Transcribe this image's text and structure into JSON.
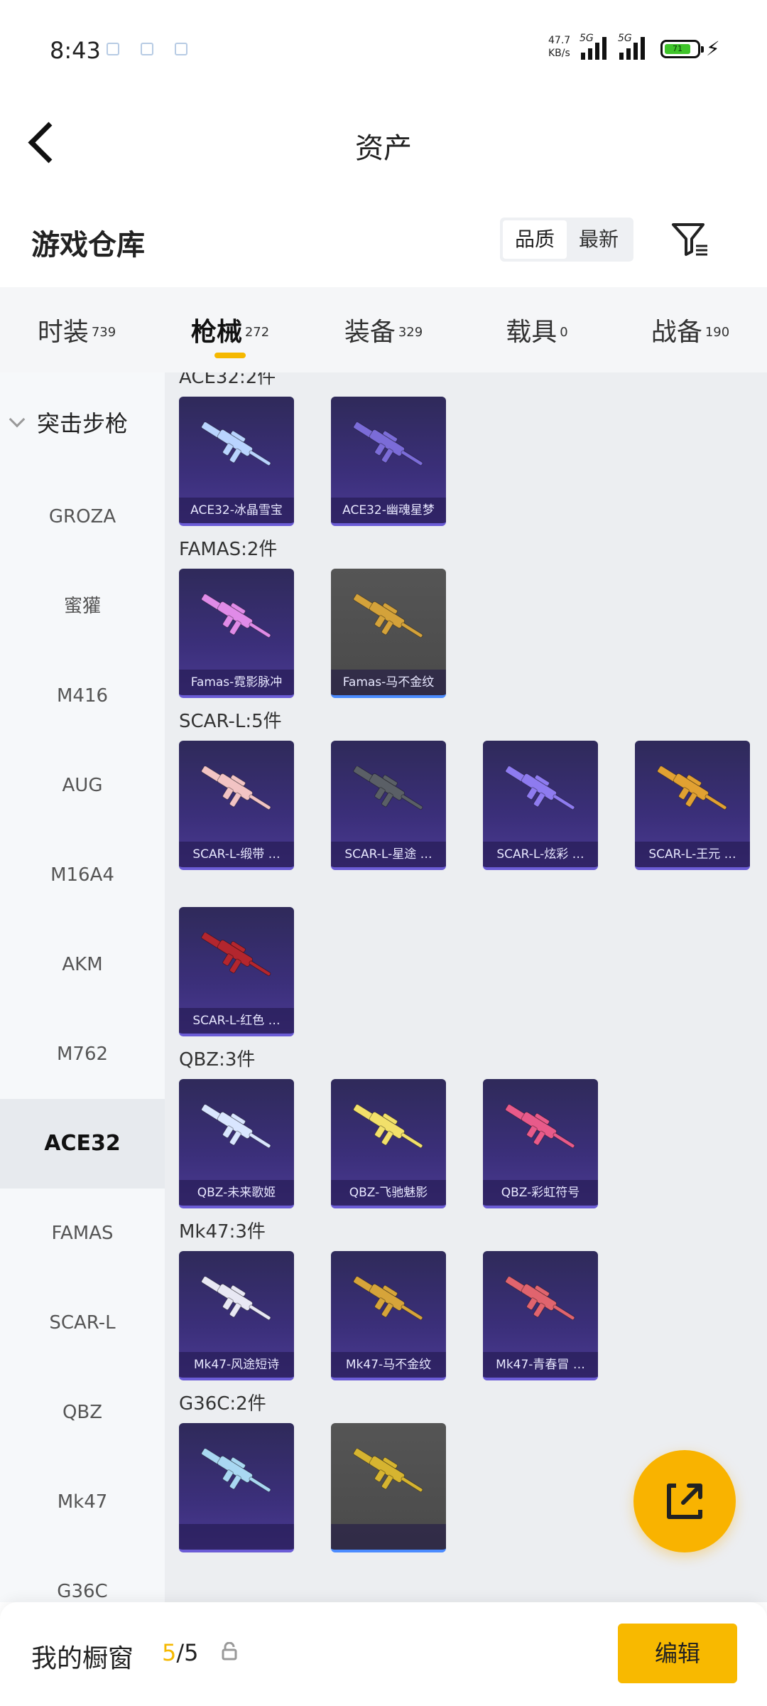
{
  "status_bar": {
    "time": "8:43",
    "network_speed_value": "47.7",
    "network_speed_unit": "KB/s",
    "sim1": "5G",
    "sim2": "5G",
    "battery": "71"
  },
  "header": {
    "title": "资产"
  },
  "warehouse": {
    "title": "游戏仓库",
    "sort_options": [
      "品质",
      "最新"
    ],
    "sort_selected": "品质"
  },
  "tabs": [
    {
      "label": "时装",
      "count": "739"
    },
    {
      "label": "枪械",
      "count": "272",
      "active": true
    },
    {
      "label": "装备",
      "count": "329"
    },
    {
      "label": "载具",
      "count": "0"
    },
    {
      "label": "战备",
      "count": "190"
    }
  ],
  "sidebar": {
    "category": "突击步枪",
    "items": [
      "GROZA",
      "蜜獾",
      "M416",
      "AUG",
      "M16A4",
      "AKM",
      "M762",
      "ACE32",
      "FAMAS",
      "SCAR-L",
      "QBZ",
      "Mk47",
      "G36C"
    ],
    "active": "ACE32"
  },
  "groups": [
    {
      "title": "ACE32:2件",
      "items": [
        {
          "name": "ACE32-冰晶雪宝",
          "style": "purple",
          "color": "#b9d4ff"
        },
        {
          "name": "ACE32-幽魂星梦",
          "style": "purple",
          "color": "#7b6cd8"
        }
      ]
    },
    {
      "title": "FAMAS:2件",
      "items": [
        {
          "name": "Famas-霓影脉冲",
          "style": "purple",
          "color": "#e08be8"
        },
        {
          "name": "Famas-马不金纹",
          "style": "gray",
          "color": "#d4a23a"
        }
      ]
    },
    {
      "title": "SCAR-L:5件",
      "items": [
        {
          "name": "SCAR-L-缎带 …",
          "style": "purple",
          "color": "#f2c4c4"
        },
        {
          "name": "SCAR-L-星途 …",
          "style": "purple",
          "color": "#5a5f66"
        },
        {
          "name": "SCAR-L-炫彩 …",
          "style": "purple",
          "color": "#8e7bf0"
        },
        {
          "name": "SCAR-L-王元 …",
          "style": "purple",
          "color": "#e1a132"
        },
        {
          "name": "SCAR-L-红色 …",
          "style": "purple",
          "color": "#b3262e"
        }
      ]
    },
    {
      "title": "QBZ:3件",
      "items": [
        {
          "name": "QBZ-未来歌姬",
          "style": "purple",
          "color": "#d9e6ff"
        },
        {
          "name": "QBZ-飞驰魅影",
          "style": "purple",
          "color": "#f2e06a"
        },
        {
          "name": "QBZ-彩虹符号",
          "style": "purple",
          "color": "#e85a8a"
        }
      ]
    },
    {
      "title": "Mk47:3件",
      "items": [
        {
          "name": "Mk47-风途短诗",
          "style": "purple",
          "color": "#e8e8f4"
        },
        {
          "name": "Mk47-马不金纹",
          "style": "purple",
          "color": "#d6a43a"
        },
        {
          "name": "Mk47-青春冒 …",
          "style": "purple",
          "color": "#e0646e"
        }
      ]
    },
    {
      "title": "G36C:2件",
      "items": [
        {
          "name": "",
          "style": "purple",
          "color": "#a9d8f2"
        },
        {
          "name": "",
          "style": "gray",
          "color": "#d6b430"
        }
      ]
    }
  ],
  "bottom_bar": {
    "label": "我的橱窗",
    "count_current": "5",
    "count_sep_total": "/5",
    "edit_label": "编辑"
  },
  "colors": {
    "accent": "#f8b900",
    "active_tab_underline": "#f5b800"
  }
}
